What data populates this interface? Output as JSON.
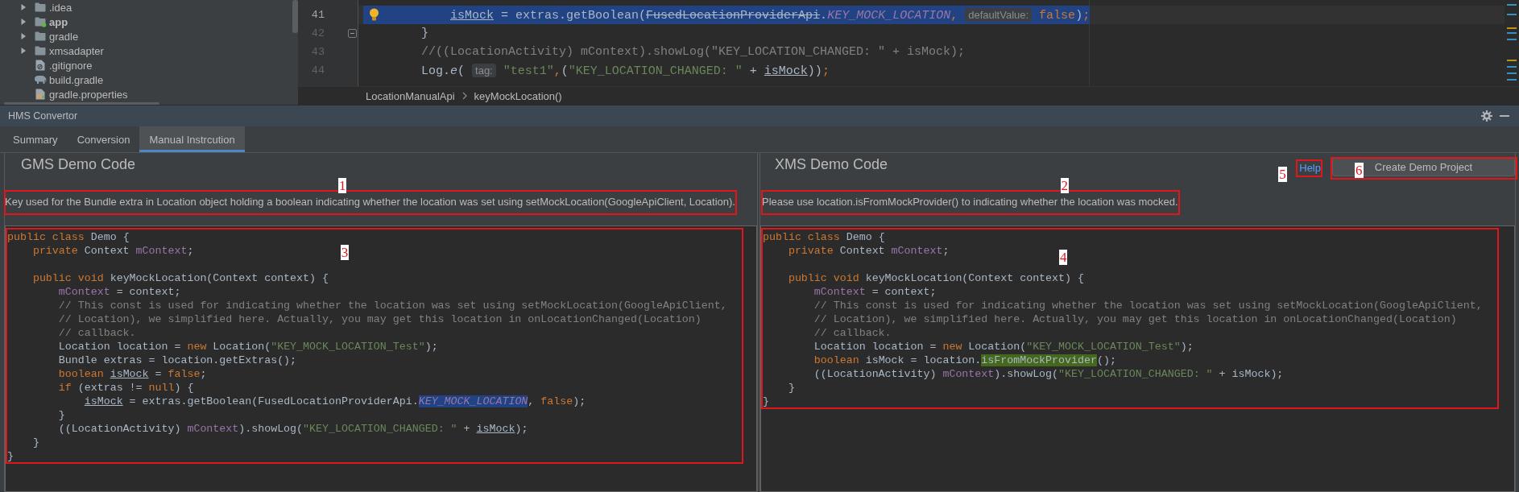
{
  "project_tree": {
    "items": [
      {
        "label": ".idea",
        "kind": "folder",
        "expanded": false
      },
      {
        "label": "app",
        "kind": "module",
        "expanded": false
      },
      {
        "label": "gradle",
        "kind": "folder",
        "expanded": false
      },
      {
        "label": "xmsadapter",
        "kind": "folder",
        "expanded": false
      },
      {
        "label": ".gitignore",
        "kind": "ignore-file"
      },
      {
        "label": "build.gradle",
        "kind": "gradle-file"
      },
      {
        "label": "gradle.properties",
        "kind": "properties-file"
      }
    ]
  },
  "editor": {
    "lines": [
      {
        "number": "41",
        "selected": true,
        "fold_marker": false,
        "tokens": [
          {
            "text": "            isMock",
            "kind": "reassigned"
          },
          {
            "text": " = extras.getBoolean(",
            "kind": "plain"
          },
          {
            "text": "FusedLocationProviderApi",
            "kind": "deprecated"
          },
          {
            "text": ".",
            "kind": "plain"
          },
          {
            "text": "KEY_MOCK_LOCATION",
            "kind": "constant"
          },
          {
            "text": ", ",
            "kind": "keyword"
          },
          {
            "text": "defaultValue:",
            "kind": "hint"
          },
          {
            "text": " false",
            "kind": "keyword"
          },
          {
            "text": ")",
            "kind": "plain"
          },
          {
            "text": ";",
            "kind": "keyword"
          }
        ]
      },
      {
        "number": "42",
        "selected": false,
        "fold_marker": true,
        "tokens": [
          {
            "text": "        }",
            "kind": "plain"
          }
        ]
      },
      {
        "number": "43",
        "selected": false,
        "fold_marker": false,
        "tokens": [
          {
            "text": "        //((LocationActivity) mContext).showLog(\"KEY_LOCATION_CHANGED: \" + isMock);",
            "kind": "comment"
          }
        ]
      },
      {
        "number": "44",
        "selected": false,
        "fold_marker": false,
        "tokens": [
          {
            "text": "        Log.",
            "kind": "plain"
          },
          {
            "text": "e",
            "kind": "static"
          },
          {
            "text": "( ",
            "kind": "plain"
          },
          {
            "text": "tag:",
            "kind": "hint"
          },
          {
            "text": " \"test1\"",
            "kind": "string"
          },
          {
            "text": ",",
            "kind": "keyword"
          },
          {
            "text": "(",
            "kind": "plain"
          },
          {
            "text": "\"KEY_LOCATION_CHANGED: \"",
            "kind": "string"
          },
          {
            "text": " + ",
            "kind": "plain"
          },
          {
            "text": "isMock",
            "kind": "reassigned"
          },
          {
            "text": "))",
            "kind": "plain"
          },
          {
            "text": ";",
            "kind": "keyword"
          }
        ]
      }
    ],
    "breadcrumbs": [
      "LocationManualApi",
      "keyMockLocation()"
    ]
  },
  "tool_window": {
    "title": "HMS Convertor",
    "tabs": [
      {
        "label": "Summary",
        "selected": false
      },
      {
        "label": "Conversion",
        "selected": false
      },
      {
        "label": "Manual Instrcution",
        "selected": true
      }
    ]
  },
  "gms_panel": {
    "title": "GMS Demo Code",
    "description": {
      "text": "Key used for the Bundle extra in Location object holding a boolean indicating whether the location was set using setMockLocation(GoogleApiClient, Location).",
      "annotation": "1"
    },
    "code": {
      "annotation": "3",
      "lines": [
        {
          "kind": "code",
          "tokens": [
            {
              "text": "public class",
              "kind": "keyword"
            },
            {
              "text": " Demo {",
              "kind": "plain"
            }
          ]
        },
        {
          "kind": "code",
          "tokens": [
            {
              "text": "    private",
              "kind": "keyword"
            },
            {
              "text": " Context ",
              "kind": "plain"
            },
            {
              "text": "mContext",
              "kind": "field"
            },
            {
              "text": ";",
              "kind": "plain"
            }
          ]
        },
        {
          "kind": "blank"
        },
        {
          "kind": "code",
          "tokens": [
            {
              "text": "    public void",
              "kind": "keyword"
            },
            {
              "text": " keyMockLocation(Context context) {",
              "kind": "plain"
            }
          ]
        },
        {
          "kind": "code",
          "tokens": [
            {
              "text": "        mContext",
              "kind": "field"
            },
            {
              "text": " = context;",
              "kind": "plain"
            }
          ]
        },
        {
          "kind": "code",
          "tokens": [
            {
              "text": "        // This const is used for indicating whether the location was set using setMockLocation(GoogleApiClient,",
              "kind": "comment"
            }
          ]
        },
        {
          "kind": "code",
          "tokens": [
            {
              "text": "        // Location), we simplified here. Actually, you may get this location in onLocationChanged(Location)",
              "kind": "comment"
            }
          ]
        },
        {
          "kind": "code",
          "tokens": [
            {
              "text": "        // callback.",
              "kind": "comment"
            }
          ]
        },
        {
          "kind": "code",
          "tokens": [
            {
              "text": "        Location location = ",
              "kind": "plain"
            },
            {
              "text": "new",
              "kind": "keyword"
            },
            {
              "text": " Location(",
              "kind": "plain"
            },
            {
              "text": "\"KEY_MOCK_LOCATION_Test\"",
              "kind": "string"
            },
            {
              "text": ");",
              "kind": "plain"
            }
          ]
        },
        {
          "kind": "code",
          "tokens": [
            {
              "text": "        Bundle extras = location.getExtras();",
              "kind": "plain"
            }
          ]
        },
        {
          "kind": "code",
          "tokens": [
            {
              "text": "        boolean ",
              "kind": "keyword"
            },
            {
              "text": "isMock",
              "kind": "reassigned"
            },
            {
              "text": " = ",
              "kind": "plain"
            },
            {
              "text": "false",
              "kind": "keyword"
            },
            {
              "text": ";",
              "kind": "plain"
            }
          ]
        },
        {
          "kind": "code",
          "tokens": [
            {
              "text": "        if",
              "kind": "keyword"
            },
            {
              "text": " (extras != ",
              "kind": "plain"
            },
            {
              "text": "null",
              "kind": "keyword"
            },
            {
              "text": ") {",
              "kind": "plain"
            }
          ]
        },
        {
          "kind": "code",
          "tokens": [
            {
              "text": "            isMock",
              "kind": "reassigned"
            },
            {
              "text": " = extras.getBoolean(FusedLocationProviderApi.",
              "kind": "plain"
            },
            {
              "text": "KEY_MOCK_LOCATION",
              "kind": "selected-constant"
            },
            {
              "text": ", ",
              "kind": "plain"
            },
            {
              "text": "false",
              "kind": "keyword"
            },
            {
              "text": ");",
              "kind": "plain"
            }
          ]
        },
        {
          "kind": "code",
          "tokens": [
            {
              "text": "        }",
              "kind": "plain"
            }
          ]
        },
        {
          "kind": "code",
          "tokens": [
            {
              "text": "        ((LocationActivity) ",
              "kind": "plain"
            },
            {
              "text": "mContext",
              "kind": "field"
            },
            {
              "text": ").showLog(",
              "kind": "plain"
            },
            {
              "text": "\"KEY_LOCATION_CHANGED: \"",
              "kind": "string"
            },
            {
              "text": " + ",
              "kind": "plain"
            },
            {
              "text": "isMock",
              "kind": "reassigned"
            },
            {
              "text": ");",
              "kind": "plain"
            }
          ]
        },
        {
          "kind": "code",
          "tokens": [
            {
              "text": "    }",
              "kind": "plain"
            }
          ]
        },
        {
          "kind": "code",
          "tokens": [
            {
              "text": "}",
              "kind": "plain"
            }
          ]
        }
      ]
    }
  },
  "xms_panel": {
    "title": "XMS Demo Code",
    "help_link": {
      "label": "Help",
      "annotation": "5"
    },
    "create_button": {
      "label": "Create Demo Project",
      "annotation": "6"
    },
    "description": {
      "text": "Please use location.isFromMockProvider() to indicating whether the location was mocked.",
      "annotation": "2"
    },
    "code": {
      "annotation": "4",
      "lines": [
        {
          "kind": "code",
          "tokens": [
            {
              "text": "public class",
              "kind": "keyword"
            },
            {
              "text": " Demo {",
              "kind": "plain"
            }
          ]
        },
        {
          "kind": "code",
          "tokens": [
            {
              "text": "    private",
              "kind": "keyword"
            },
            {
              "text": " Context ",
              "kind": "plain"
            },
            {
              "text": "mContext",
              "kind": "field"
            },
            {
              "text": ";",
              "kind": "plain"
            }
          ]
        },
        {
          "kind": "blank"
        },
        {
          "kind": "code",
          "tokens": [
            {
              "text": "    public void",
              "kind": "keyword"
            },
            {
              "text": " keyMockLocation(Context context) {",
              "kind": "plain"
            }
          ]
        },
        {
          "kind": "code",
          "tokens": [
            {
              "text": "        mContext",
              "kind": "field"
            },
            {
              "text": " = context;",
              "kind": "plain"
            }
          ]
        },
        {
          "kind": "code",
          "tokens": [
            {
              "text": "        // This const is used for indicating whether the location was set using setMockLocation(GoogleApiClient,",
              "kind": "comment"
            }
          ]
        },
        {
          "kind": "code",
          "tokens": [
            {
              "text": "        // Location), we simplified here. Actually, you may get this location in onLocationChanged(Location)",
              "kind": "comment"
            }
          ]
        },
        {
          "kind": "code",
          "tokens": [
            {
              "text": "        // callback.",
              "kind": "comment"
            }
          ]
        },
        {
          "kind": "code",
          "tokens": [
            {
              "text": "        Location location = ",
              "kind": "plain"
            },
            {
              "text": "new",
              "kind": "keyword"
            },
            {
              "text": " Location(",
              "kind": "plain"
            },
            {
              "text": "\"KEY_MOCK_LOCATION_Test\"",
              "kind": "string"
            },
            {
              "text": ");",
              "kind": "plain"
            }
          ]
        },
        {
          "kind": "code",
          "tokens": [
            {
              "text": "        boolean",
              "kind": "keyword"
            },
            {
              "text": " isMock = location.",
              "kind": "plain"
            },
            {
              "text": "isFromMockProvider",
              "kind": "matched-method"
            },
            {
              "text": "();",
              "kind": "plain"
            }
          ]
        },
        {
          "kind": "code",
          "tokens": [
            {
              "text": "        ((LocationActivity) ",
              "kind": "plain"
            },
            {
              "text": "mContext",
              "kind": "field"
            },
            {
              "text": ").showLog(",
              "kind": "plain"
            },
            {
              "text": "\"KEY_LOCATION_CHANGED: \"",
              "kind": "string"
            },
            {
              "text": " + isMock);",
              "kind": "plain"
            }
          ]
        },
        {
          "kind": "code",
          "tokens": [
            {
              "text": "    }",
              "kind": "plain"
            }
          ]
        },
        {
          "kind": "code",
          "tokens": [
            {
              "text": "}",
              "kind": "plain"
            }
          ]
        }
      ]
    }
  }
}
